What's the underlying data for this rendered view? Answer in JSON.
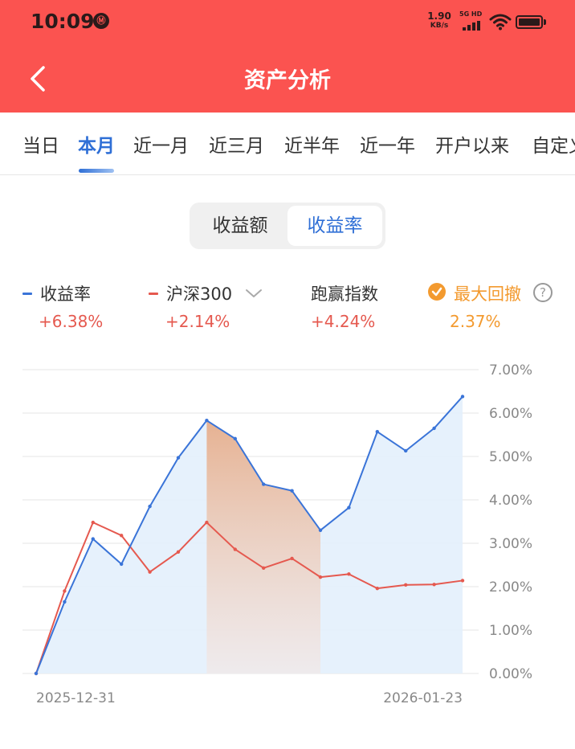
{
  "status_bar": {
    "time": "10:09",
    "badge": "Ⓜ",
    "net_speed_value": "1.90",
    "net_speed_unit": "KB/s",
    "network_type": "5G HD"
  },
  "header": {
    "title": "资产分析"
  },
  "tabs": [
    "当日",
    "本月",
    "近一月",
    "近三月",
    "近半年",
    "近一年",
    "开户以来",
    "自定义"
  ],
  "active_tab": "本月",
  "toggle": {
    "left": "收益额",
    "right": "收益率"
  },
  "legend": [
    {
      "label": "收益率",
      "value": "+6.38%",
      "color": "#3a74d8"
    },
    {
      "label": "沪深300",
      "value": "+2.14%",
      "color": "#e5594f"
    },
    {
      "label": "跑赢指数",
      "value": "+4.24%"
    },
    {
      "label": "最大回撤",
      "value": "2.37%",
      "color": "#f39a2f"
    }
  ],
  "colors": {
    "header": "#fb5350",
    "accent": "#2f6fd6",
    "gain": "#e5594f",
    "drawdown": "#f39a2f"
  },
  "chart_data": {
    "type": "line",
    "x_start_label": "2025-12-31",
    "x_end_label": "2026-01-23",
    "y_ticks": [
      "0.00%",
      "1.00%",
      "2.00%",
      "3.00%",
      "4.00%",
      "5.00%",
      "6.00%",
      "7.00%"
    ],
    "ylim": [
      0,
      7
    ],
    "series": [
      {
        "name": "收益率",
        "color": "#3a74d8",
        "fill": true,
        "values": [
          0.0,
          1.65,
          3.1,
          2.52,
          3.85,
          4.97,
          5.83,
          5.41,
          4.36,
          4.21,
          3.3,
          3.82,
          5.57,
          5.13,
          5.65,
          6.38
        ]
      },
      {
        "name": "沪深300",
        "color": "#e5594f",
        "fill": false,
        "values": [
          0.0,
          1.9,
          3.48,
          3.18,
          2.34,
          2.8,
          3.48,
          2.86,
          2.43,
          2.65,
          2.22,
          2.29,
          1.96,
          2.04,
          2.05,
          2.14
        ]
      }
    ],
    "max_drawdown": {
      "value": "2.37%",
      "start_index": 6,
      "end_index": 10
    },
    "grid": true
  }
}
